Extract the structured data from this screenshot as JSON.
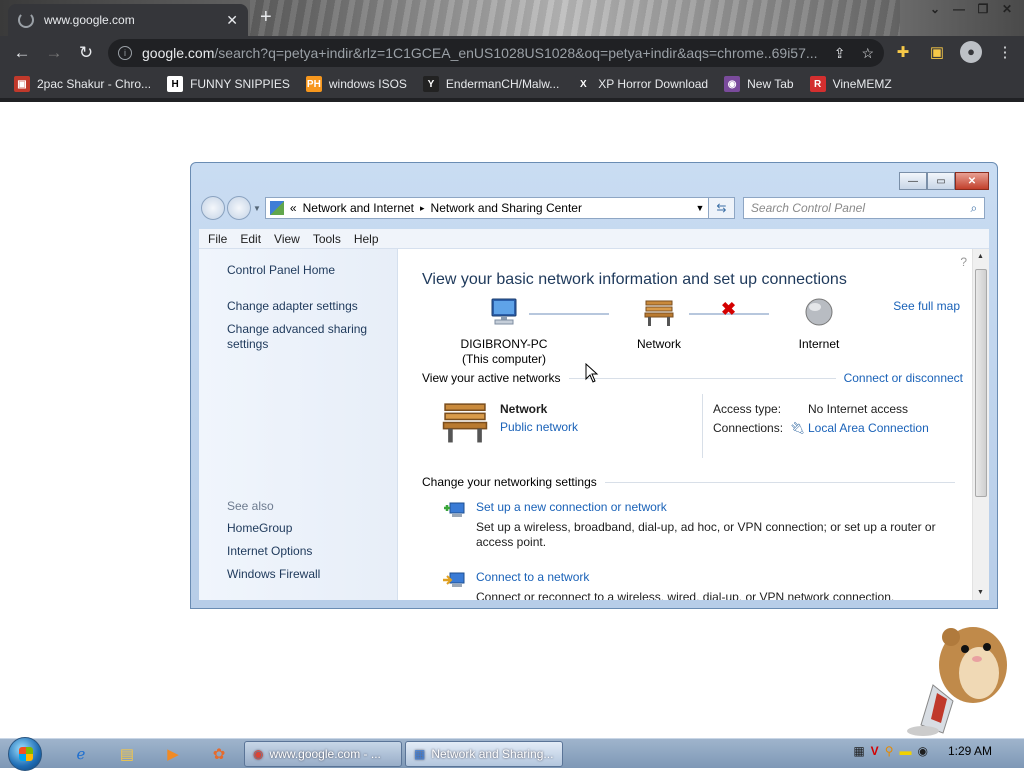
{
  "browser": {
    "tab_title": "www.google.com",
    "tab_close": "✕",
    "new_tab": "+",
    "url_domain": "google.com",
    "url_rest": "/search?q=petya+indir&rlz=1C1GCEA_enUS1028US1028&oq=petya+indir&aqs=chrome..69i57...",
    "bookmarks": [
      {
        "label": "2pac Shakur - Chro...",
        "icon_text": "▣",
        "icon_bg": "#c0392b"
      },
      {
        "label": "FUNNY SNIPPIES",
        "icon_text": "H",
        "icon_bg": "#ffffff"
      },
      {
        "label": "windows ISOS",
        "icon_text": "PH",
        "icon_bg": "#f7971d"
      },
      {
        "label": "EndermanCH/Malw...",
        "icon_text": "Y",
        "icon_bg": "#222222"
      },
      {
        "label": "XP Horror Download",
        "icon_text": "X",
        "icon_bg": "#35363a"
      },
      {
        "label": "New Tab",
        "icon_text": "◉",
        "icon_bg": "#7a4b9c"
      },
      {
        "label": "VineMEMZ",
        "icon_text": "R",
        "icon_bg": "#d32f2f"
      }
    ]
  },
  "explorer": {
    "breadcrumb_prefix": "«",
    "breadcrumb_1": "Network and Internet",
    "breadcrumb_sep": "▸",
    "breadcrumb_2": "Network and Sharing Center",
    "search_placeholder": "Search Control Panel",
    "menu": [
      "File",
      "Edit",
      "View",
      "Tools",
      "Help"
    ],
    "sidebar": {
      "home": "Control Panel Home",
      "adapter": "Change adapter settings",
      "advanced": "Change advanced sharing settings",
      "see_also": "See also",
      "homegroup": "HomeGroup",
      "internet_options": "Internet Options",
      "firewall": "Windows Firewall"
    },
    "main": {
      "title": "View your basic network information and set up connections",
      "see_full_map": "See full map",
      "computer_name": "DIGIBRONY-PC",
      "computer_sub": "(This computer)",
      "network_label": "Network",
      "internet_label": "Internet",
      "active_networks_heading": "View your active networks",
      "connect_or_disconnect": "Connect or disconnect",
      "active_network_name": "Network",
      "active_network_type": "Public network",
      "access_type_label": "Access type:",
      "access_type_value": "No Internet access",
      "connections_label": "Connections:",
      "connections_value": "Local Area Connection",
      "change_settings_heading": "Change your networking settings",
      "tasks": [
        {
          "title": "Set up a new connection or network",
          "desc": "Set up a wireless, broadband, dial-up, ad hoc, or VPN connection; or set up a router or access point."
        },
        {
          "title": "Connect to a network",
          "desc": "Connect or reconnect to a wireless, wired, dial-up, or VPN network connection."
        }
      ]
    }
  },
  "taskbar": {
    "chrome_button": "www.google.com - ...",
    "explorer_button": "Network and Sharing...",
    "clock": "1:29 AM"
  }
}
